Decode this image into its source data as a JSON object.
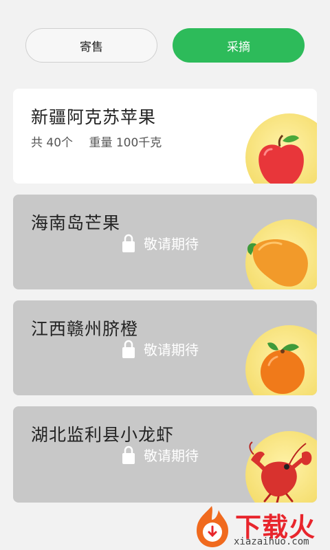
{
  "tabs": {
    "consign_label": "寄售",
    "pick_label": "采摘",
    "active": "采摘"
  },
  "items": [
    {
      "title": "新疆阿克苏苹果",
      "count": "共 40个",
      "weight": "重量 100千克",
      "status": "available",
      "fruit_icon": "apple-icon"
    },
    {
      "title": "海南岛芒果",
      "coming_label": "敬请期待",
      "status": "locked",
      "fruit_icon": "mango-icon"
    },
    {
      "title": "江西赣州脐橙",
      "coming_label": "敬请期待",
      "status": "locked",
      "fruit_icon": "orange-icon"
    },
    {
      "title": "湖北监利县小龙虾",
      "coming_label": "敬请期待",
      "status": "locked",
      "fruit_icon": "crayfish-icon"
    }
  ],
  "watermark": {
    "brand": "下载火",
    "url": "xiazaihuo.com"
  },
  "colors": {
    "accent": "#2dbb5a",
    "locked_card": "#c8c8c8",
    "background": "#f2f2f2"
  }
}
